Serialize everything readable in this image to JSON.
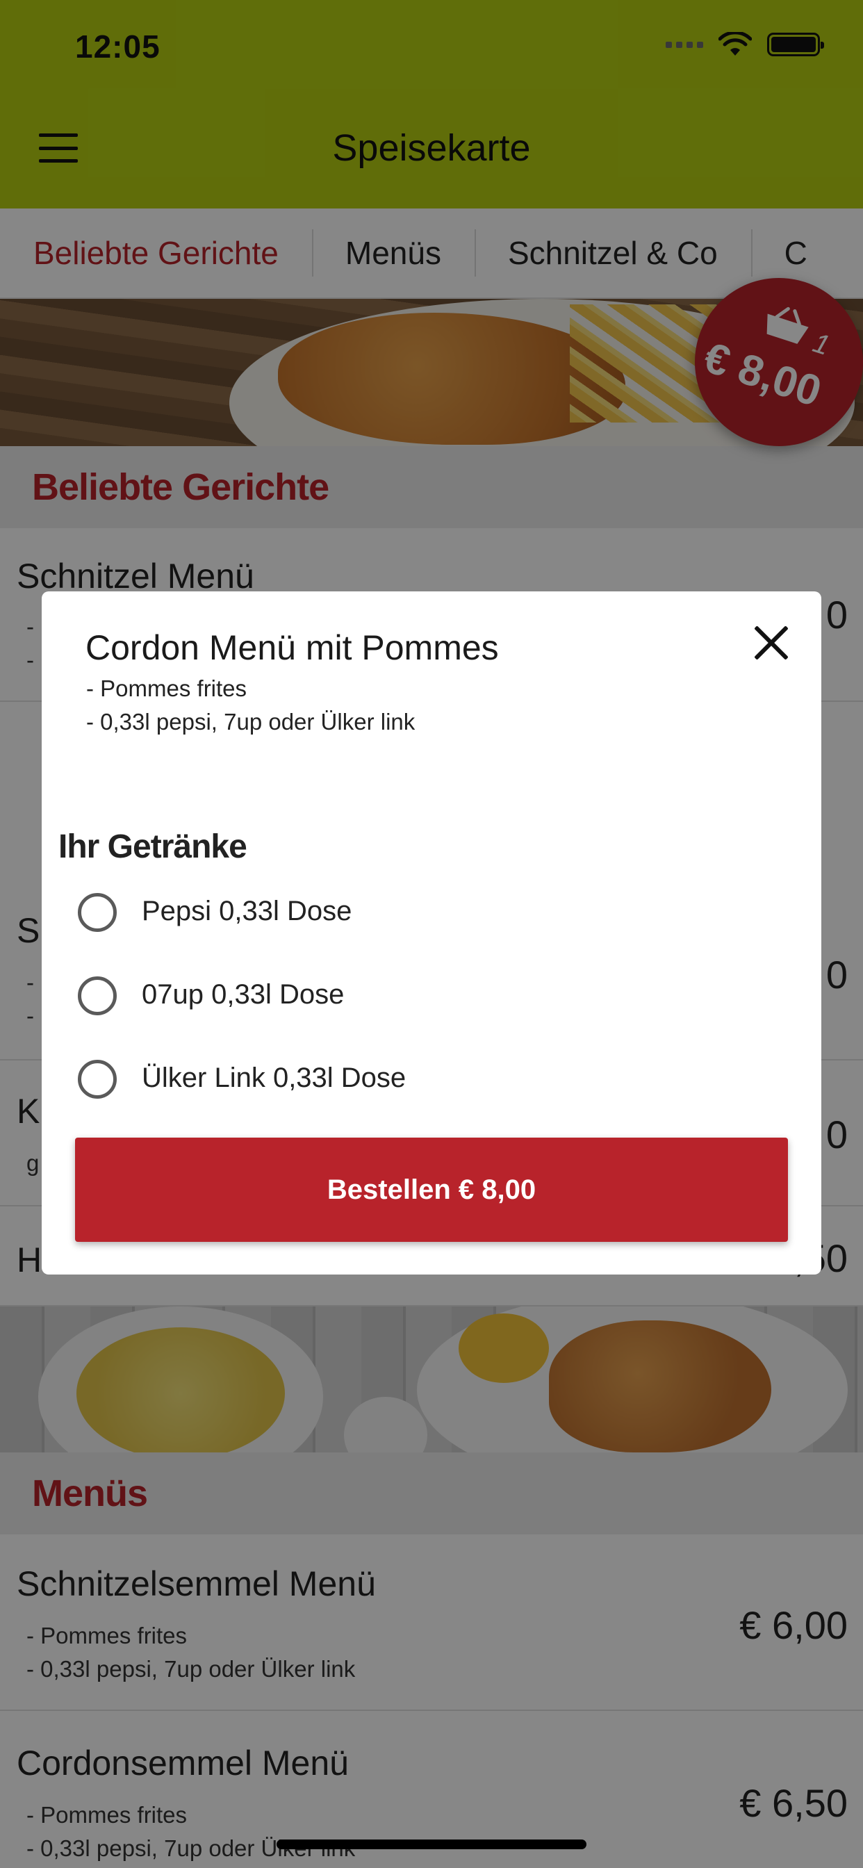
{
  "status_bar": {
    "time": "12:05"
  },
  "nav": {
    "title": "Speisekarte"
  },
  "tabs": [
    {
      "label": "Beliebte Gerichte",
      "active": true
    },
    {
      "label": "Menüs"
    },
    {
      "label": "Schnitzel & Co"
    },
    {
      "label": "C"
    }
  ],
  "cart": {
    "count": "1",
    "total": "€ 8,00"
  },
  "sections": [
    {
      "title": "Beliebte Gerichte",
      "items": [
        {
          "name": "Schnitzel Menü",
          "desc": [
            "-",
            "-"
          ],
          "price": "0"
        },
        {
          "name": "S",
          "desc": [
            "-",
            "-"
          ],
          "price": "0"
        },
        {
          "name": "K",
          "desc": [
            "g"
          ],
          "price": "0"
        },
        {
          "name": "H",
          "price": "€ 7,50"
        }
      ]
    },
    {
      "title": "Menüs",
      "items": [
        {
          "name": "Schnitzelsemmel Menü",
          "desc": [
            "- Pommes frites",
            "- 0,33l pepsi, 7up oder Ülker link"
          ],
          "price": "€ 6,00"
        },
        {
          "name": "Cordonsemmel  Menü",
          "desc": [
            "- Pommes frites",
            "- 0,33l pepsi, 7up oder Ülker link"
          ],
          "price": "€ 6,50"
        }
      ]
    }
  ],
  "modal": {
    "title": "Cordon Menü mit Pommes",
    "desc": [
      "- Pommes frites",
      "- 0,33l pepsi, 7up oder Ülker link"
    ],
    "group_label": "Ihr Getränke",
    "options": [
      {
        "label": "Pepsi  0,33l Dose",
        "selected": false
      },
      {
        "label": "07up 0,33l Dose",
        "selected": false
      },
      {
        "label": "Ülker Link 0,33l Dose",
        "selected": false
      }
    ],
    "order_button": "Bestellen € 8,00"
  },
  "colors": {
    "nav_bg": "#b5cf12",
    "accent": "#b8232b"
  }
}
